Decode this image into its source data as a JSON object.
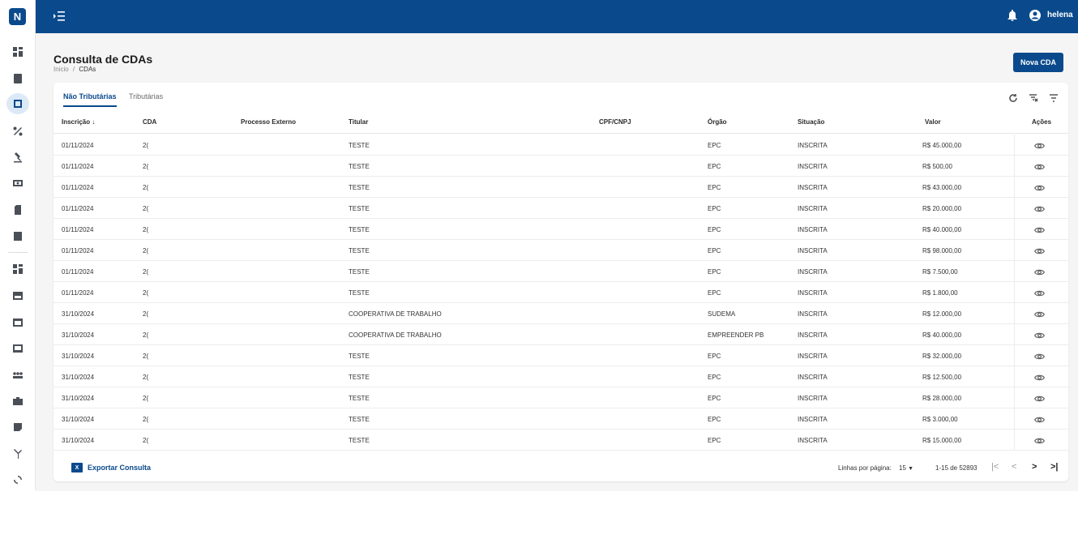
{
  "app": {
    "logo": "N",
    "user": "helena"
  },
  "page": {
    "title": "Consulta de CDAs",
    "breadcrumb": {
      "home": "Inicio",
      "separator": "/",
      "current": "CDAs"
    },
    "new_button": "Nova CDA"
  },
  "tabs": [
    {
      "label": "Não Tributárias",
      "active": true
    },
    {
      "label": "Tributárias",
      "active": false
    }
  ],
  "columns": {
    "inscricao": "Inscrição",
    "sort_icon": "↓",
    "cda": "CDA",
    "processo": "Processo Externo",
    "titular": "Titular",
    "cpf": "CPF/CNPJ",
    "orgao": "Órgão",
    "situacao": "Situação",
    "valor": "Valor",
    "acoes": "Ações"
  },
  "rows": [
    {
      "data": "01/11/2024",
      "cda": "2(",
      "titular": "TESTE",
      "orgao": "EPC",
      "situacao": "INSCRITA",
      "valor": "R$ 45.000,00"
    },
    {
      "data": "01/11/2024",
      "cda": "2(",
      "titular": "TESTE",
      "orgao": "EPC",
      "situacao": "INSCRITA",
      "valor": "R$ 500,00"
    },
    {
      "data": "01/11/2024",
      "cda": "2(",
      "titular": "TESTE",
      "orgao": "EPC",
      "situacao": "INSCRITA",
      "valor": "R$ 43.000,00"
    },
    {
      "data": "01/11/2024",
      "cda": "2(",
      "titular": "TESTE",
      "orgao": "EPC",
      "situacao": "INSCRITA",
      "valor": "R$ 20.000,00"
    },
    {
      "data": "01/11/2024",
      "cda": "2(",
      "titular": "TESTE",
      "orgao": "EPC",
      "situacao": "INSCRITA",
      "valor": "R$ 40.000,00"
    },
    {
      "data": "01/11/2024",
      "cda": "2(",
      "titular": "TESTE",
      "orgao": "EPC",
      "situacao": "INSCRITA",
      "valor": "R$ 98.000,00"
    },
    {
      "data": "01/11/2024",
      "cda": "2(",
      "titular": "TESTE",
      "orgao": "EPC",
      "situacao": "INSCRITA",
      "valor": "R$ 7.500,00"
    },
    {
      "data": "01/11/2024",
      "cda": "2(",
      "titular": "TESTE",
      "orgao": "EPC",
      "situacao": "INSCRITA",
      "valor": "R$ 1.800,00"
    },
    {
      "data": "31/10/2024",
      "cda": "2(",
      "titular": "COOPERATIVA DE TRABALHO",
      "orgao": "SUDEMA",
      "situacao": "INSCRITA",
      "valor": "R$ 12.000,00"
    },
    {
      "data": "31/10/2024",
      "cda": "2(",
      "titular": "COOPERATIVA DE TRABALHO",
      "orgao": "EMPREENDER PB",
      "situacao": "INSCRITA",
      "valor": "R$ 40.000,00"
    },
    {
      "data": "31/10/2024",
      "cda": "2(",
      "titular": "TESTE",
      "orgao": "EPC",
      "situacao": "INSCRITA",
      "valor": "R$ 32.000,00"
    },
    {
      "data": "31/10/2024",
      "cda": "2(",
      "titular": "TESTE",
      "orgao": "EPC",
      "situacao": "INSCRITA",
      "valor": "R$ 12.500,00"
    },
    {
      "data": "31/10/2024",
      "cda": "2(",
      "titular": "TESTE",
      "orgao": "EPC",
      "situacao": "INSCRITA",
      "valor": "R$ 28.000,00"
    },
    {
      "data": "31/10/2024",
      "cda": "2(",
      "titular": "TESTE",
      "orgao": "EPC",
      "situacao": "INSCRITA",
      "valor": "R$ 3.000,00"
    },
    {
      "data": "31/10/2024",
      "cda": "2(",
      "titular": "TESTE",
      "orgao": "EPC",
      "situacao": "INSCRITA",
      "valor": "R$ 15.000,00"
    }
  ],
  "footer": {
    "export_icon": "X",
    "export_label": "Exportar Consulta",
    "rows_per_page_label": "Linhas por página:",
    "rows_per_page": "15",
    "range": "1-15 de 52893",
    "first": "|<",
    "prev": "<",
    "next": ">",
    "last": ">|"
  },
  "colors": {
    "primary": "#0a4a8c",
    "background": "#f5f5f5"
  }
}
